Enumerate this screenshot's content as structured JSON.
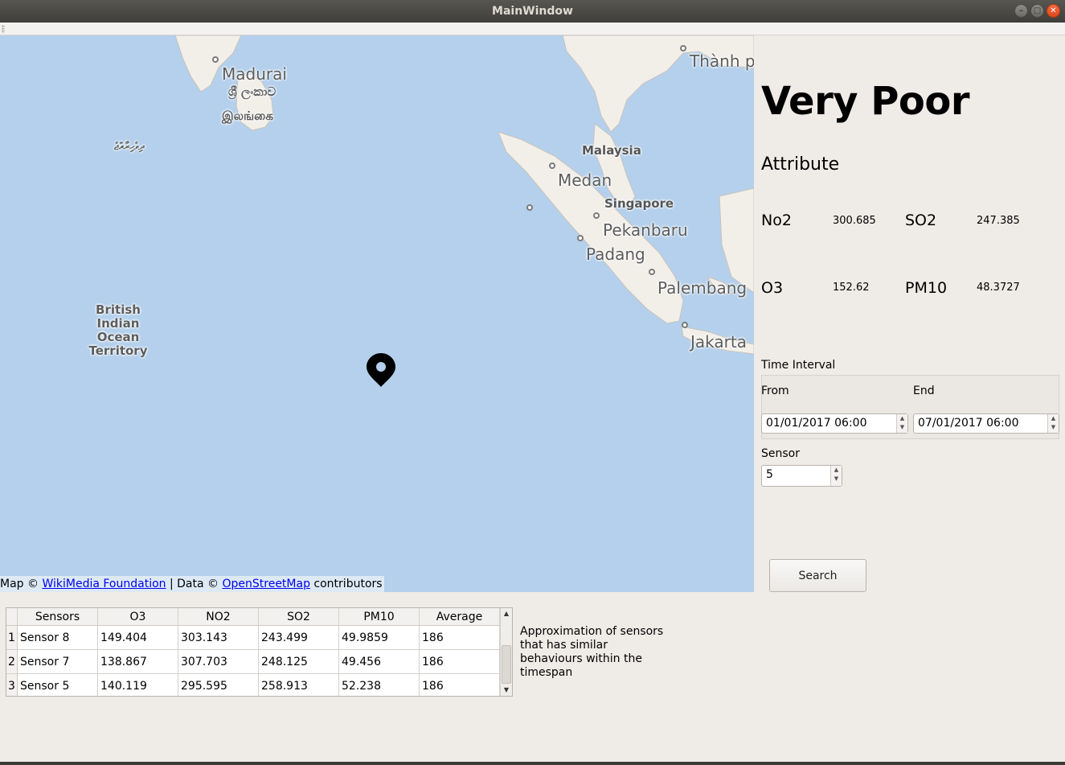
{
  "window": {
    "title": "MainWindow"
  },
  "map": {
    "labels": {
      "madurai": "Madurai",
      "srilanka_si": "ශ්‍රී ලංකාව",
      "srilanka_ta": "இலங்கை",
      "maldives": "ދިވެހިރާއްޖެ",
      "thanh": "Thành p",
      "malaysia": "Malaysia",
      "medan": "Medan",
      "singapore": "Singapore",
      "pekanbaru": "Pekanbaru",
      "padang": "Padang",
      "palembang": "Palembang",
      "jakarta": "Jakarta",
      "biot": "British Indian Ocean Territory"
    },
    "attribution": {
      "prefix": "Map © ",
      "link1": "WikiMedia Foundation",
      "middle": " | Data © ",
      "link2": "OpenStreetMap",
      "suffix": " contributors"
    },
    "marker_icon": "map-pin-icon"
  },
  "status": {
    "title": "Very Poor"
  },
  "attributes": {
    "heading": "Attribute",
    "no2": {
      "name": "No2",
      "value": "300.685"
    },
    "so2": {
      "name": "SO2",
      "value": "247.385"
    },
    "o3": {
      "name": "O3",
      "value": "152.62"
    },
    "pm10": {
      "name": "PM10",
      "value": "48.3727"
    }
  },
  "time_interval": {
    "label": "Time Interval",
    "from_label": "From",
    "end_label": "End",
    "from_value": "01/01/2017 06:00",
    "end_value": "07/01/2017 06:00"
  },
  "sensor": {
    "label": "Sensor",
    "value": "5"
  },
  "search": {
    "label": "Search"
  },
  "table": {
    "columns": [
      "Sensors",
      "O3",
      "NO2",
      "SO2",
      "PM10",
      "Average"
    ],
    "rows": [
      {
        "index": "1",
        "cells": [
          "Sensor 8",
          "149.404",
          "303.143",
          "243.499",
          "49.9859",
          "186"
        ]
      },
      {
        "index": "2",
        "cells": [
          "Sensor 7",
          "138.867",
          "307.703",
          "248.125",
          "49.456",
          "186"
        ]
      },
      {
        "index": "3",
        "cells": [
          "Sensor 5",
          "140.119",
          "295.595",
          "258.913",
          "52.238",
          "186"
        ]
      }
    ]
  },
  "approximation_note": "Approximation of sensors that has similar behaviours within the timespan"
}
